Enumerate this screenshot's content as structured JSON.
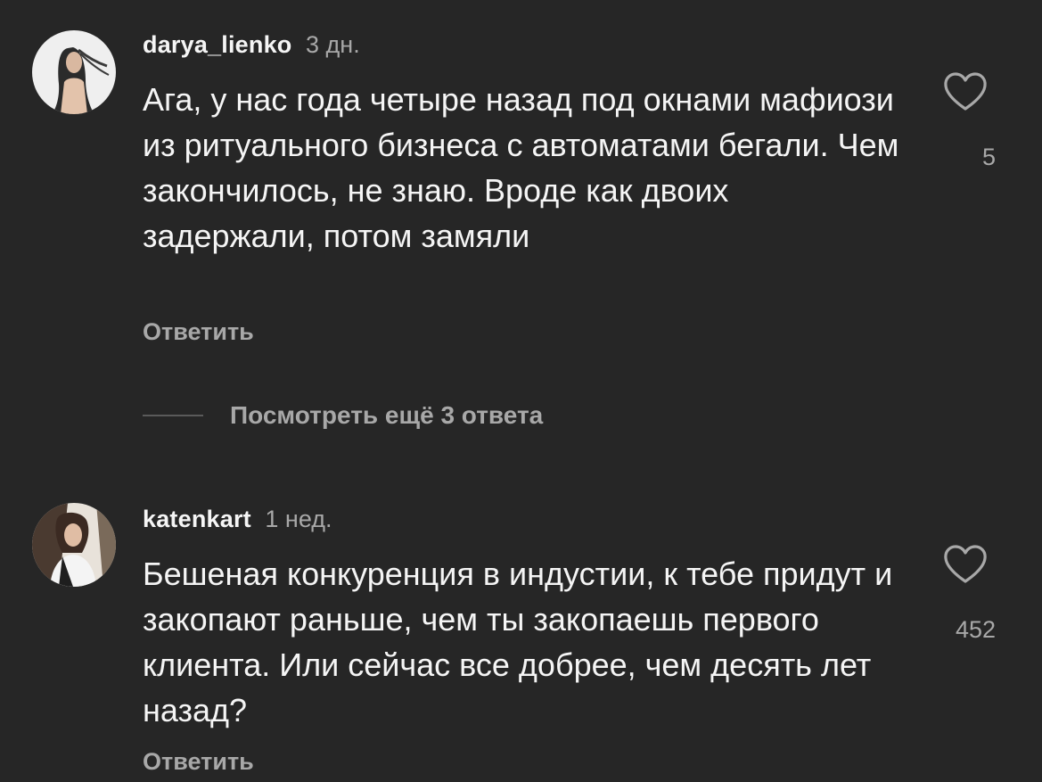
{
  "comments": [
    {
      "username": "darya_lienko",
      "time": "3 дн.",
      "text": "Ага, у нас года четыре назад под окнами мафиози из ритуального бизнеса с автоматами бегали. Чем закончилось, не знаю. Вроде как двоих задержали, потом замяли",
      "reply_label": "Ответить",
      "likes": "5",
      "like_icon": "heart-outline-icon"
    },
    {
      "username": "katenkart",
      "time": "1 нед.",
      "text": "Бешеная конкуренция в индустии, к тебе придут и закопают раньше, чем ты закопаешь первого клиента. Или сейчас все добрее, чем десять лет назад?",
      "reply_label": "Ответить",
      "likes": "452",
      "like_icon": "heart-outline-icon"
    }
  ],
  "view_replies_label": "Посмотреть ещё 3 ответа",
  "colors": {
    "background": "#262626",
    "primary_text": "#f5f5f5",
    "secondary_text": "#a8a8a8"
  }
}
